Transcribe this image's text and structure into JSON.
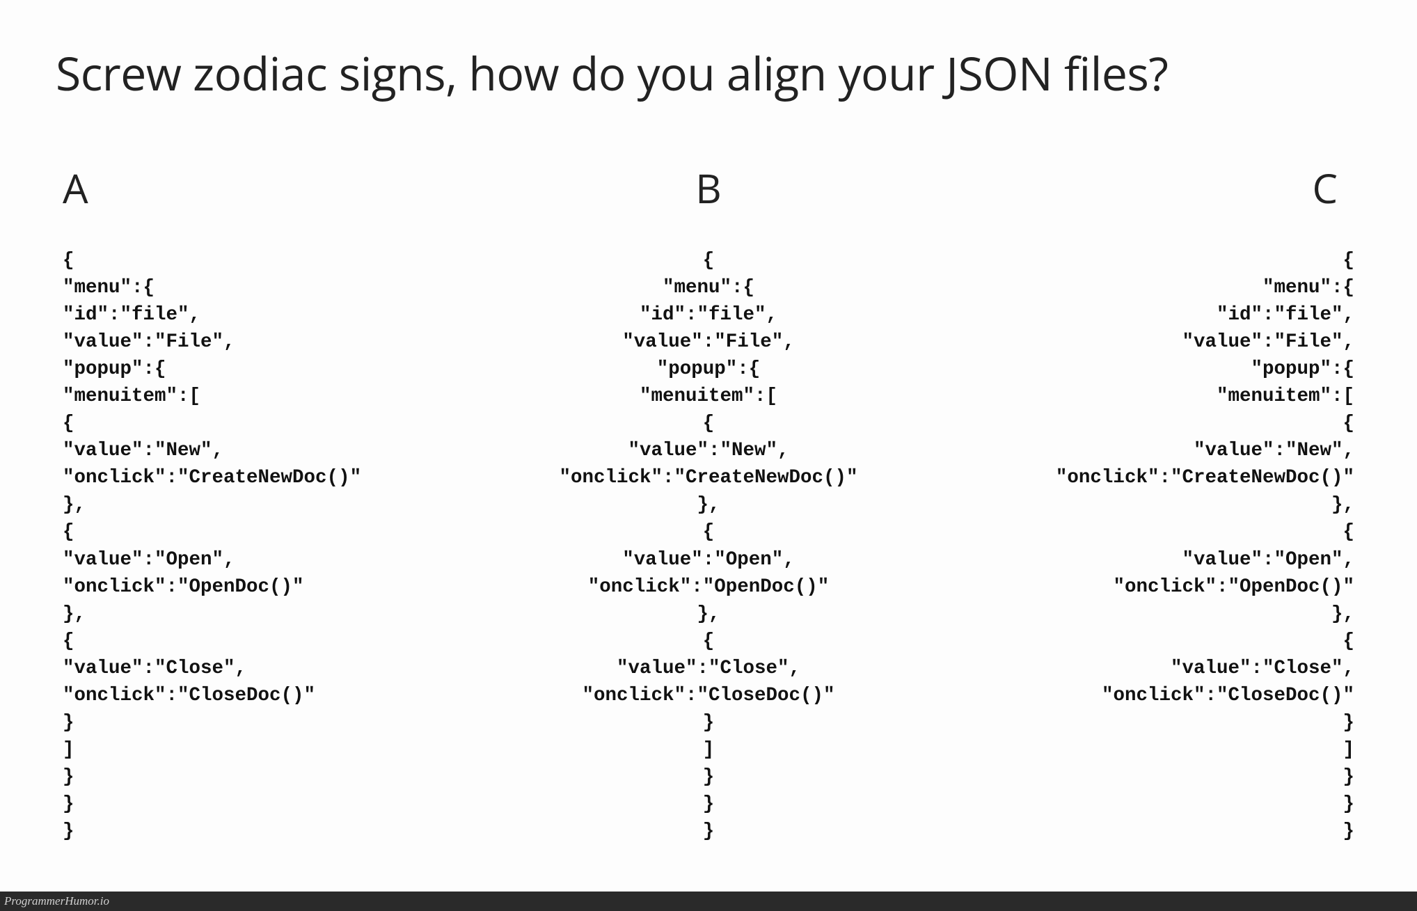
{
  "title": "Screw zodiac signs, how do you align your JSON files?",
  "labels": {
    "a": "A",
    "b": "B",
    "c": "C"
  },
  "code_lines": [
    "{",
    "\"menu\":{",
    "\"id\":\"file\",",
    "\"value\":\"File\",",
    "\"popup\":{",
    "\"menuitem\":[",
    "{",
    "\"value\":\"New\",",
    "\"onclick\":\"CreateNewDoc()\"",
    "},",
    "{",
    "\"value\":\"Open\",",
    "\"onclick\":\"OpenDoc()\"",
    "},",
    "{",
    "\"value\":\"Close\",",
    "\"onclick\":\"CloseDoc()\"",
    "}",
    "]",
    "}",
    "}",
    "}"
  ],
  "footer": "ProgrammerHumor.io"
}
